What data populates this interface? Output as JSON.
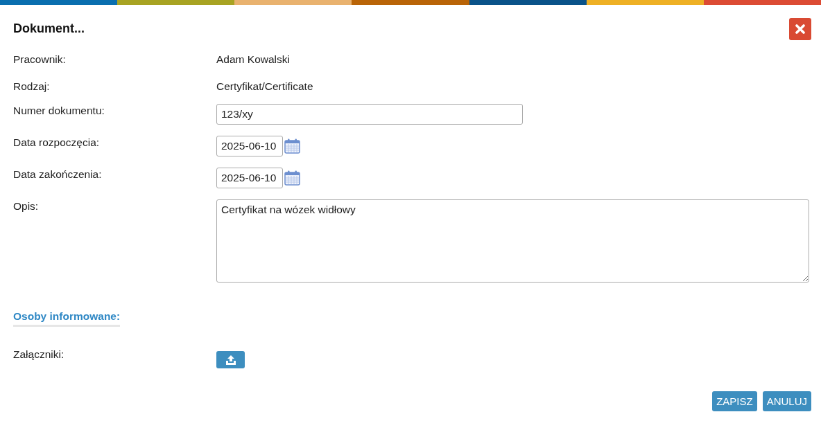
{
  "dialog": {
    "title": "Dokument..."
  },
  "fields": [
    {
      "label": "Pracownik:",
      "kind": "text",
      "value": "Adam Kowalski"
    },
    {
      "label": "Rodzaj:",
      "kind": "text",
      "value": "Certyfikat/Certificate"
    },
    {
      "label": "Numer dokumentu:",
      "kind": "input",
      "value": "123/xy"
    },
    {
      "label": "Data rozpoczęcia:",
      "kind": "date",
      "value": "2025-06-10"
    },
    {
      "label": "Data zakończenia:",
      "kind": "date",
      "value": "2025-06-10"
    },
    {
      "label": "Opis:",
      "kind": "textarea",
      "value": "Certyfikat na wózek widłowy"
    }
  ],
  "section_heading": "Osoby informowane:",
  "attachments": {
    "label": "Załączniki:"
  },
  "buttons": [
    "ZAPISZ",
    "ANULUJ"
  ]
}
